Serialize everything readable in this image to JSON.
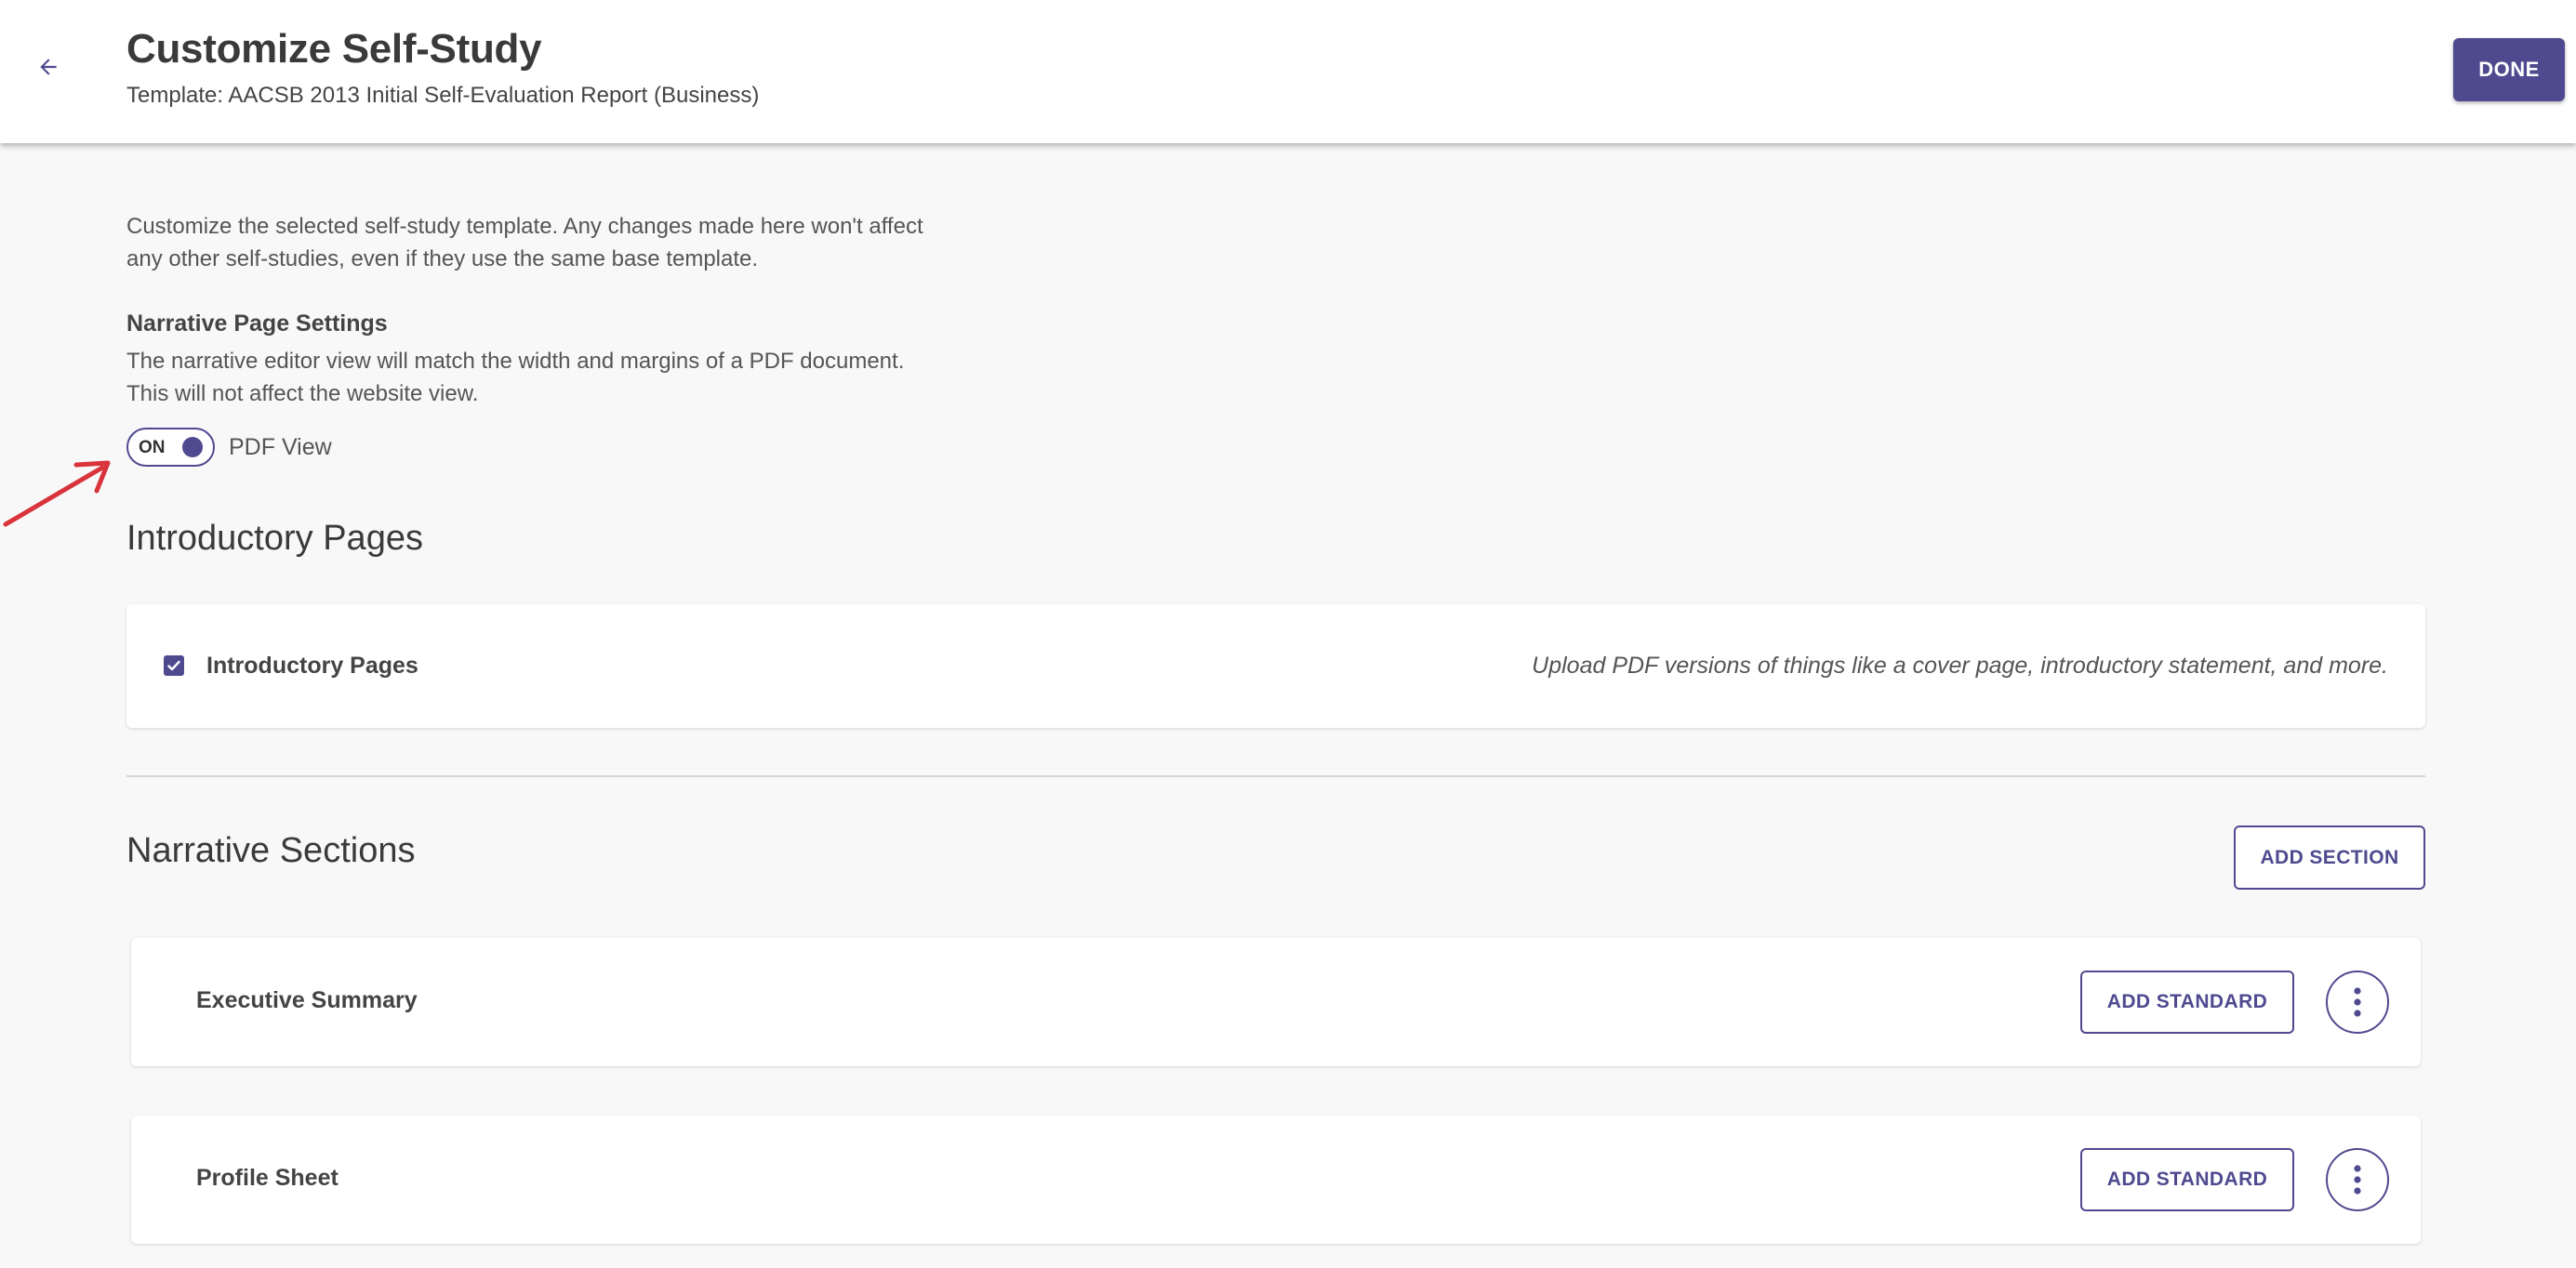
{
  "header": {
    "title": "Customize Self-Study",
    "subtitle": "Template: AACSB 2013 Initial Self-Evaluation Report (Business)",
    "done_label": "DONE",
    "back_icon": "arrow-left-icon"
  },
  "intro": {
    "description": "Customize the selected self-study template. Any changes made here won't affect any other self-studies, even if they use the same base template."
  },
  "narrative_settings": {
    "heading": "Narrative Page Settings",
    "description": "The narrative editor view will match the width and margins of a PDF document. This will not affect the website view.",
    "toggle_state": "ON",
    "toggle_label": "PDF View"
  },
  "introductory_pages": {
    "title": "Introductory Pages",
    "item_label": "Introductory Pages",
    "checked": true,
    "hint": "Upload PDF versions of things like a cover page, introductory statement, and more."
  },
  "narrative_sections": {
    "title": "Narrative Sections",
    "add_section_label": "ADD SECTION",
    "items": [
      {
        "label": "Executive Summary",
        "add_standard_label": "ADD STANDARD"
      },
      {
        "label": "Profile Sheet",
        "add_standard_label": "ADD STANDARD"
      }
    ]
  },
  "colors": {
    "accent": "#4f4a8f",
    "annotation_arrow": "#d9333b",
    "background": "#f8f8f8"
  }
}
